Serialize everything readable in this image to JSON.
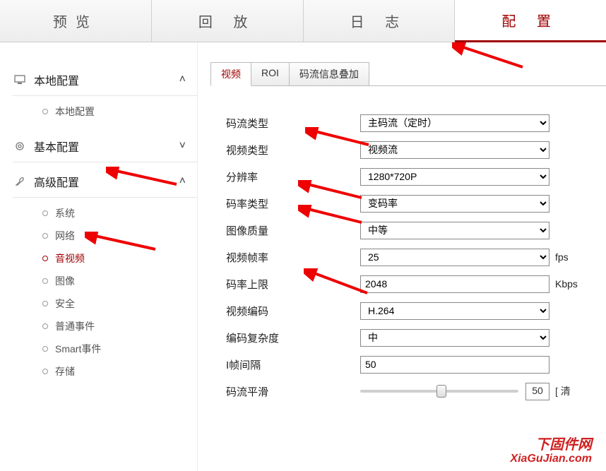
{
  "tabs": {
    "preview": "预览",
    "playback": "回 放",
    "log": "日 志",
    "config": "配 置"
  },
  "sidebar": {
    "local": {
      "label": "本地配置",
      "items": [
        "本地配置"
      ]
    },
    "basic": {
      "label": "基本配置"
    },
    "advanced": {
      "label": "高级配置",
      "items": [
        "系统",
        "网络",
        "音视频",
        "图像",
        "安全",
        "普通事件",
        "Smart事件",
        "存储"
      ]
    }
  },
  "subtabs": {
    "video": "视频",
    "roi": "ROI",
    "overlay": "码流信息叠加"
  },
  "fields": {
    "stream_type": {
      "label": "码流类型",
      "value": "主码流（定时）"
    },
    "video_type": {
      "label": "视频类型",
      "value": "视频流"
    },
    "resolution": {
      "label": "分辨率",
      "value": "1280*720P"
    },
    "bitrate_type": {
      "label": "码率类型",
      "value": "变码率"
    },
    "image_quality": {
      "label": "图像质量",
      "value": "中等"
    },
    "frame_rate": {
      "label": "视频帧率",
      "value": "25",
      "unit": "fps"
    },
    "max_bitrate": {
      "label": "码率上限",
      "value": "2048",
      "unit": "Kbps"
    },
    "video_encoding": {
      "label": "视频编码",
      "value": "H.264"
    },
    "complexity": {
      "label": "编码复杂度",
      "value": "中"
    },
    "iframe": {
      "label": "I帧间隔",
      "value": "50"
    },
    "smoothing": {
      "label": "码流平滑",
      "value": "50",
      "suffix": "[ 清"
    }
  },
  "watermark": {
    "l1": "下固件网",
    "l2": "XiaGuJian.com"
  }
}
